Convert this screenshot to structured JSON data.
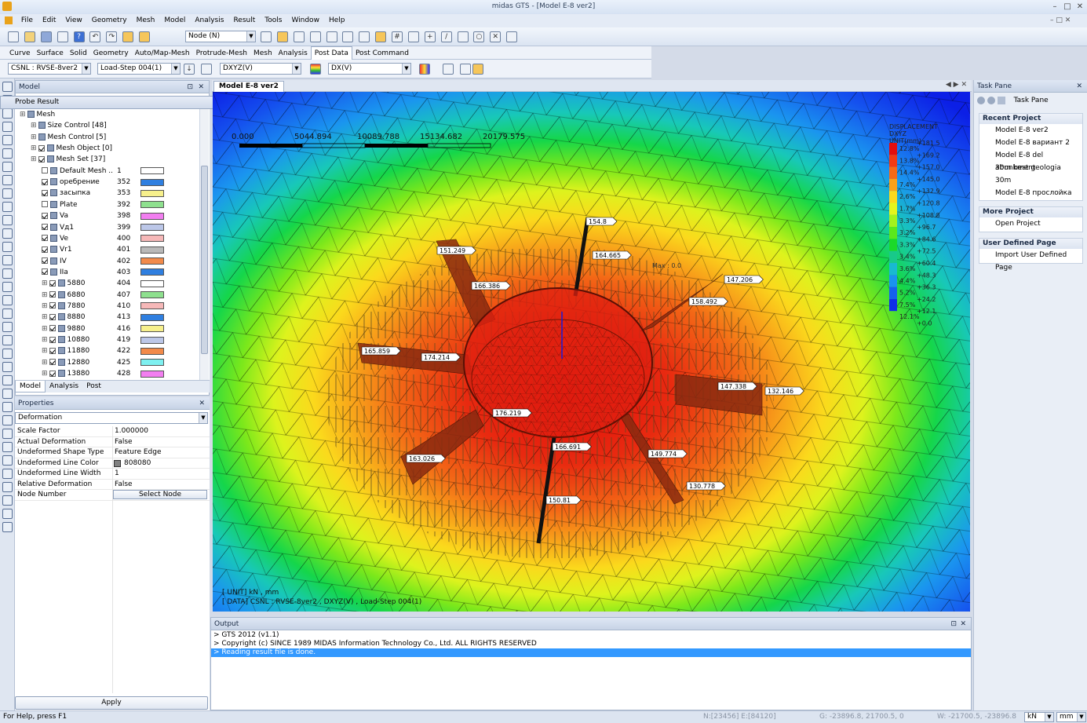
{
  "app": {
    "title": "midas GTS - [Model E-8 ver2]"
  },
  "menu": [
    "File",
    "Edit",
    "View",
    "Geometry",
    "Mesh",
    "Model",
    "Analysis",
    "Result",
    "Tools",
    "Window",
    "Help"
  ],
  "toolbar": {
    "select_mode": "Node (N)"
  },
  "ribbon_tabs": [
    "Curve",
    "Surface",
    "Solid",
    "Geometry",
    "Auto/Map-Mesh",
    "Protrude-Mesh",
    "Mesh",
    "Analysis",
    "Post Data",
    "Post Command"
  ],
  "ribbon_active": "Post Data",
  "post": {
    "result_set": "CSNL : RVSE-8ver2",
    "step": "Load-Step 004(1)",
    "component": "DXYZ(V)",
    "direction": "DX(V)"
  },
  "model_panel": {
    "title": "Model",
    "probe": "Probe Result",
    "tree": [
      {
        "label": "Mesh",
        "level": 0,
        "check": null,
        "id": "",
        "color": ""
      },
      {
        "label": "Size Control [48]",
        "level": 1,
        "check": null,
        "id": "",
        "color": ""
      },
      {
        "label": "Mesh Control [5]",
        "level": 1,
        "check": null,
        "id": "",
        "color": ""
      },
      {
        "label": "Mesh Object [0]",
        "level": 1,
        "check": true,
        "id": "",
        "color": ""
      },
      {
        "label": "Mesh Set [37]",
        "level": 1,
        "check": true,
        "id": "",
        "color": ""
      },
      {
        "label": "Default Mesh ..",
        "level": 2,
        "check": false,
        "id": "1",
        "color": "#ffffff"
      },
      {
        "label": "оребрение",
        "level": 2,
        "check": true,
        "id": "352",
        "color": "#2f7fe0"
      },
      {
        "label": "засыпка",
        "level": 2,
        "check": true,
        "id": "353",
        "color": "#f7f08c"
      },
      {
        "label": "Plate",
        "level": 2,
        "check": false,
        "id": "392",
        "color": "#8ee08e"
      },
      {
        "label": "Va",
        "level": 2,
        "check": true,
        "id": "398",
        "color": "#f27ef0"
      },
      {
        "label": "Vд1",
        "level": 2,
        "check": true,
        "id": "399",
        "color": "#bcc7e8"
      },
      {
        "label": "Ve",
        "level": 2,
        "check": true,
        "id": "400",
        "color": "#f6b8b8"
      },
      {
        "label": "Vr1",
        "level": 2,
        "check": true,
        "id": "401",
        "color": "#b9b9b9"
      },
      {
        "label": "IV",
        "level": 2,
        "check": true,
        "id": "402",
        "color": "#f28a4a"
      },
      {
        "label": "IIa",
        "level": 2,
        "check": true,
        "id": "403",
        "color": "#2f7fe0"
      },
      {
        "label": "5880",
        "level": 2,
        "check": true,
        "id": "404",
        "color": "#ffffff"
      },
      {
        "label": "6880",
        "level": 2,
        "check": true,
        "id": "407",
        "color": "#8ee08e"
      },
      {
        "label": "7880",
        "level": 2,
        "check": true,
        "id": "410",
        "color": "#f6b8b8"
      },
      {
        "label": "8880",
        "level": 2,
        "check": true,
        "id": "413",
        "color": "#2f7fe0"
      },
      {
        "label": "9880",
        "level": 2,
        "check": true,
        "id": "416",
        "color": "#f7f08c"
      },
      {
        "label": "10880",
        "level": 2,
        "check": true,
        "id": "419",
        "color": "#bcc7e8"
      },
      {
        "label": "11880",
        "level": 2,
        "check": true,
        "id": "422",
        "color": "#f28a4a"
      },
      {
        "label": "12880",
        "level": 2,
        "check": true,
        "id": "425",
        "color": "#7ef0f0"
      },
      {
        "label": "13880",
        "level": 2,
        "check": true,
        "id": "428",
        "color": "#f27ef0"
      }
    ],
    "bottom_tabs": [
      "Model",
      "Analysis",
      "Post"
    ]
  },
  "properties": {
    "title": "Properties",
    "selected": "Deformation",
    "rows": [
      {
        "name": "Scale Factor",
        "value": "1.000000"
      },
      {
        "name": "Actual Deformation",
        "value": "False"
      },
      {
        "name": "Undeformed Shape Type",
        "value": "Feature Edge"
      },
      {
        "name": "Undeformed Line Color",
        "value": "808080"
      },
      {
        "name": "Undeformed Line Width",
        "value": "1"
      },
      {
        "name": "Relative Deformation",
        "value": "False"
      },
      {
        "name": "Node Number",
        "value": "Select Node"
      }
    ],
    "apply": "Apply"
  },
  "viewport": {
    "tab": "Model E-8 ver2",
    "scale_labels": [
      "0.000",
      "5044.894",
      "10089.788",
      "15134.682",
      "20179.575"
    ],
    "legend": {
      "title": "DISPLACEMENT",
      "comp": "DXYZ",
      "unit": "UNIT(mm)",
      "values": [
        "+181.5",
        "+169.2",
        "+157.0",
        "+145.0",
        "+132.9",
        "+120.8",
        "+108.8",
        "+96.7",
        "+84.6",
        "+72.5",
        "+60.4",
        "+48.3",
        "+36.3",
        "+24.2",
        "+12.1",
        "+0.0"
      ],
      "percents": [
        "12.8%",
        "13.8%",
        "14.4%",
        "7.4%",
        "2.6%",
        "1.7%",
        "3.3%",
        "3.2%",
        "3.3%",
        "3.4%",
        "3.6%",
        "4.4%",
        "5.2%",
        "7.5%",
        "12.1%"
      ],
      "colors": [
        "#e40d0d",
        "#f23a14",
        "#f66a17",
        "#f9a11a",
        "#fbd91c",
        "#e4f51d",
        "#a3f21d",
        "#5be81b",
        "#1bd92a",
        "#18c98a",
        "#19b9d1",
        "#1a93f0",
        "#1561ee",
        "#0f2ee8"
      ]
    },
    "max_label": "Max : 0.0",
    "probes": [
      "154.8",
      "164.665",
      "151.249",
      "166.386",
      "147.206",
      "158.492",
      "165.859",
      "174.214",
      "147.338",
      "132.146",
      "176.219",
      "163.026",
      "166.691",
      "149.774",
      "130.778",
      "150.81"
    ],
    "info_unit": "[ UNIT]  kN  , mm",
    "info_data": "[ DATA]  CSNL : RVSE-8ver2  ,  DXYZ(V)  ,  Load-Step 004(1)"
  },
  "output": {
    "title": "Output",
    "lines": [
      "> GTS 2012 (v1.1)",
      "> Copyright (c) SINCE 1989 MIDAS Information Technology Co., Ltd. ALL RIGHTS RESERVED",
      "> Reading result file is done."
    ]
  },
  "taskpane": {
    "title": "Task Pane",
    "header": "Task Pane",
    "recent_title": "Recent Project",
    "recent": [
      "Model E-8 ver2",
      "Model E-8 вариант 2",
      "Model E-8 del abunkment",
      "30m best geologia",
      "30m",
      "Model E-8 прослойка"
    ],
    "more_title": "More Project",
    "more": [
      "Open Project"
    ],
    "user_title": "User Defined Page",
    "user": [
      "Import User Defined Page"
    ]
  },
  "status": {
    "help": "For Help, press F1",
    "node": "N:[23456] E:[84120]",
    "g": "G: -23896.8, 21700.5, 0",
    "w": "W: -21700.5, -23896.8",
    "force_unit": "kN",
    "length_unit": "mm"
  }
}
